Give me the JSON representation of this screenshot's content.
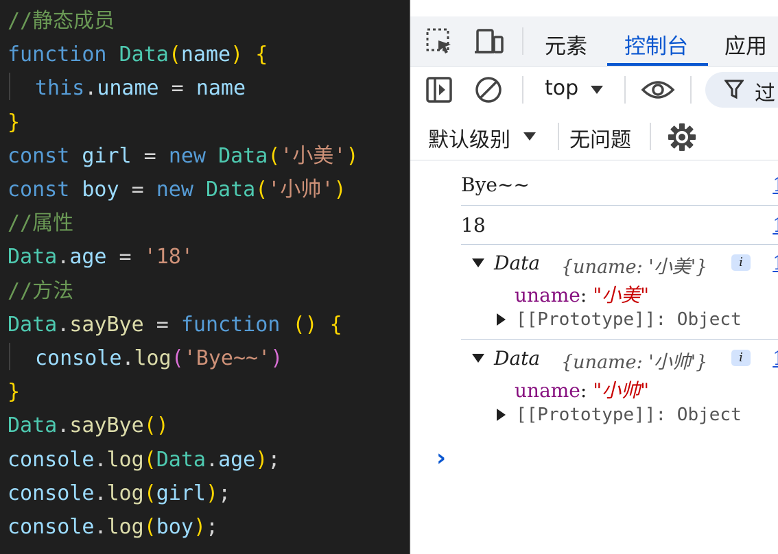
{
  "editor": {
    "lines": [
      [
        {
          "t": "//静态成员",
          "c": "cmt"
        }
      ],
      [
        {
          "t": "function",
          "c": "kw"
        },
        {
          "t": " "
        },
        {
          "t": "Data",
          "c": "type"
        },
        {
          "t": "(",
          "c": "b1"
        },
        {
          "t": "name",
          "c": "var"
        },
        {
          "t": ")",
          "c": "b1"
        },
        {
          "t": " "
        },
        {
          "t": "{",
          "c": "b1"
        }
      ],
      [
        {
          "t": "indent"
        },
        {
          "t": "this",
          "c": "kw"
        },
        {
          "t": ".",
          "c": "punc"
        },
        {
          "t": "uname",
          "c": "var"
        },
        {
          "t": " = ",
          "c": "punc"
        },
        {
          "t": "name",
          "c": "var"
        }
      ],
      [
        {
          "t": "}",
          "c": "b1"
        }
      ],
      [
        {
          "t": "const",
          "c": "kw"
        },
        {
          "t": " "
        },
        {
          "t": "girl",
          "c": "var"
        },
        {
          "t": " = ",
          "c": "punc"
        },
        {
          "t": "new",
          "c": "kw"
        },
        {
          "t": " "
        },
        {
          "t": "Data",
          "c": "type"
        },
        {
          "t": "(",
          "c": "b1"
        },
        {
          "t": "'小美'",
          "c": "str"
        },
        {
          "t": ")",
          "c": "b1"
        }
      ],
      [
        {
          "t": "const",
          "c": "kw"
        },
        {
          "t": " "
        },
        {
          "t": "boy",
          "c": "var"
        },
        {
          "t": " = ",
          "c": "punc"
        },
        {
          "t": "new",
          "c": "kw"
        },
        {
          "t": " "
        },
        {
          "t": "Data",
          "c": "type"
        },
        {
          "t": "(",
          "c": "b1"
        },
        {
          "t": "'小帅'",
          "c": "str"
        },
        {
          "t": ")",
          "c": "b1"
        }
      ],
      [
        {
          "t": "//属性",
          "c": "cmt"
        }
      ],
      [
        {
          "t": "Data",
          "c": "type"
        },
        {
          "t": ".",
          "c": "punc"
        },
        {
          "t": "age",
          "c": "var"
        },
        {
          "t": " = ",
          "c": "punc"
        },
        {
          "t": "'18'",
          "c": "str"
        }
      ],
      [
        {
          "t": "//方法",
          "c": "cmt"
        }
      ],
      [
        {
          "t": "Data",
          "c": "type"
        },
        {
          "t": ".",
          "c": "punc"
        },
        {
          "t": "sayBye",
          "c": "fn"
        },
        {
          "t": " = ",
          "c": "punc"
        },
        {
          "t": "function",
          "c": "kw"
        },
        {
          "t": " "
        },
        {
          "t": "()",
          "c": "b1"
        },
        {
          "t": " "
        },
        {
          "t": "{",
          "c": "b1"
        }
      ],
      [
        {
          "t": "indent"
        },
        {
          "t": "console",
          "c": "var"
        },
        {
          "t": ".",
          "c": "punc"
        },
        {
          "t": "log",
          "c": "fn"
        },
        {
          "t": "(",
          "c": "b2"
        },
        {
          "t": "'Bye~~'",
          "c": "str"
        },
        {
          "t": ")",
          "c": "b2"
        }
      ],
      [
        {
          "t": "}",
          "c": "b1"
        }
      ],
      [
        {
          "t": "Data",
          "c": "type"
        },
        {
          "t": ".",
          "c": "punc"
        },
        {
          "t": "sayBye",
          "c": "fn"
        },
        {
          "t": "()",
          "c": "b1"
        }
      ],
      [
        {
          "t": "console",
          "c": "var"
        },
        {
          "t": ".",
          "c": "punc"
        },
        {
          "t": "log",
          "c": "fn"
        },
        {
          "t": "(",
          "c": "b1"
        },
        {
          "t": "Data",
          "c": "type"
        },
        {
          "t": ".",
          "c": "punc"
        },
        {
          "t": "age",
          "c": "var"
        },
        {
          "t": ")",
          "c": "b1"
        },
        {
          "t": ";",
          "c": "punc"
        }
      ],
      [
        {
          "t": "console",
          "c": "var"
        },
        {
          "t": ".",
          "c": "punc"
        },
        {
          "t": "log",
          "c": "fn"
        },
        {
          "t": "(",
          "c": "b1"
        },
        {
          "t": "girl",
          "c": "var"
        },
        {
          "t": ")",
          "c": "b1"
        },
        {
          "t": ";",
          "c": "punc"
        }
      ],
      [
        {
          "t": "console",
          "c": "var"
        },
        {
          "t": ".",
          "c": "punc"
        },
        {
          "t": "log",
          "c": "fn"
        },
        {
          "t": "(",
          "c": "b1"
        },
        {
          "t": "boy",
          "c": "var"
        },
        {
          "t": ")",
          "c": "b1"
        },
        {
          "t": ";",
          "c": "punc"
        }
      ]
    ]
  },
  "devtools": {
    "tabs": {
      "elements": "元素",
      "console": "控制台",
      "application": "应用"
    },
    "toolbar": {
      "context": "top",
      "filter": "过",
      "levels": "默认级别",
      "issues": "无问题"
    },
    "console": {
      "log1": "Bye~~",
      "log2": "18",
      "obj1": {
        "class_name": "Data",
        "preview": "{uname: '小美'}",
        "prop_key": "uname",
        "prop_sep": ": ",
        "prop_value": "\"小美\"",
        "proto": "[[Prototype]]: Object",
        "badge": "i"
      },
      "obj2": {
        "class_name": "Data",
        "preview": "{uname: '小帅'}",
        "prop_key": "uname",
        "prop_sep": ": ",
        "prop_value": "\"小帅\"",
        "proto": "[[Prototype]]: Object",
        "badge": "i"
      },
      "src_link": "1",
      "prompt": "›"
    },
    "colors": {
      "accent": "#0b57d0",
      "string_red": "#c80000",
      "key_purple": "#881280"
    },
    "icons": [
      "inspect-icon",
      "device-toolbar-icon",
      "sidebar-toggle-icon",
      "clear-console-icon",
      "eye-icon",
      "filter-icon",
      "gear-icon"
    ]
  }
}
